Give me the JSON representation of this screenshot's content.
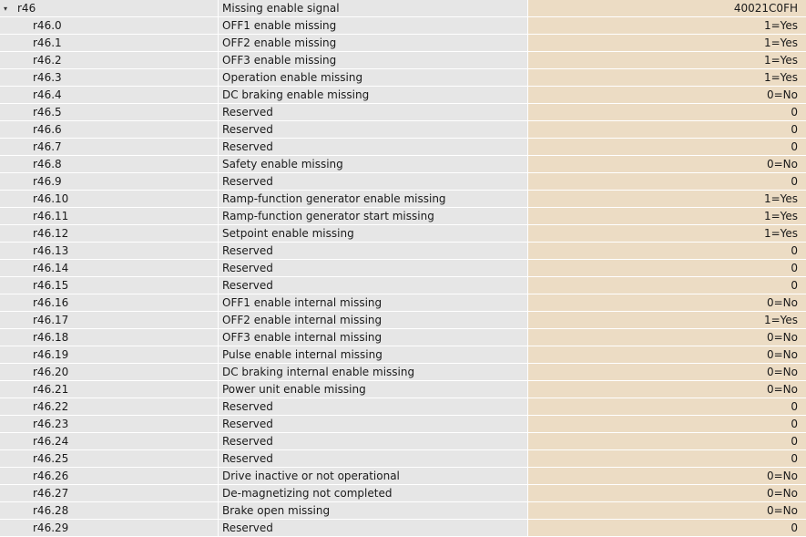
{
  "parent": {
    "param": "r46",
    "description": "Missing enable signal",
    "value": "40021C0FH",
    "expand_icon": "▾"
  },
  "rows": [
    {
      "param": "r46.0",
      "description": "OFF1 enable missing",
      "value": "1=Yes"
    },
    {
      "param": "r46.1",
      "description": "OFF2 enable missing",
      "value": "1=Yes"
    },
    {
      "param": "r46.2",
      "description": "OFF3 enable missing",
      "value": "1=Yes"
    },
    {
      "param": "r46.3",
      "description": "Operation enable missing",
      "value": "1=Yes"
    },
    {
      "param": "r46.4",
      "description": "DC braking enable missing",
      "value": "0=No"
    },
    {
      "param": "r46.5",
      "description": "Reserved",
      "value": "0"
    },
    {
      "param": "r46.6",
      "description": "Reserved",
      "value": "0"
    },
    {
      "param": "r46.7",
      "description": "Reserved",
      "value": "0"
    },
    {
      "param": "r46.8",
      "description": "Safety enable missing",
      "value": "0=No"
    },
    {
      "param": "r46.9",
      "description": "Reserved",
      "value": "0"
    },
    {
      "param": "r46.10",
      "description": "Ramp-function generator enable missing",
      "value": "1=Yes"
    },
    {
      "param": "r46.11",
      "description": "Ramp-function generator start missing",
      "value": "1=Yes"
    },
    {
      "param": "r46.12",
      "description": "Setpoint enable missing",
      "value": "1=Yes"
    },
    {
      "param": "r46.13",
      "description": "Reserved",
      "value": "0"
    },
    {
      "param": "r46.14",
      "description": "Reserved",
      "value": "0"
    },
    {
      "param": "r46.15",
      "description": "Reserved",
      "value": "0"
    },
    {
      "param": "r46.16",
      "description": "OFF1 enable internal missing",
      "value": "0=No"
    },
    {
      "param": "r46.17",
      "description": "OFF2 enable internal missing",
      "value": "1=Yes"
    },
    {
      "param": "r46.18",
      "description": "OFF3 enable internal missing",
      "value": "0=No"
    },
    {
      "param": "r46.19",
      "description": "Pulse enable internal missing",
      "value": "0=No"
    },
    {
      "param": "r46.20",
      "description": "DC braking internal enable missing",
      "value": "0=No"
    },
    {
      "param": "r46.21",
      "description": "Power unit enable missing",
      "value": "0=No"
    },
    {
      "param": "r46.22",
      "description": "Reserved",
      "value": "0"
    },
    {
      "param": "r46.23",
      "description": "Reserved",
      "value": "0"
    },
    {
      "param": "r46.24",
      "description": "Reserved",
      "value": "0"
    },
    {
      "param": "r46.25",
      "description": "Reserved",
      "value": "0"
    },
    {
      "param": "r46.26",
      "description": "Drive inactive or not operational",
      "value": "0=No"
    },
    {
      "param": "r46.27",
      "description": "De-magnetizing not completed",
      "value": "0=No"
    },
    {
      "param": "r46.28",
      "description": "Brake open missing",
      "value": "0=No"
    },
    {
      "param": "r46.29",
      "description": "Reserved",
      "value": "0"
    }
  ],
  "colors": {
    "row_background": "#e6e6e6",
    "value_background": "#ecdcc4",
    "selection_underline": "#8fb8e8"
  }
}
